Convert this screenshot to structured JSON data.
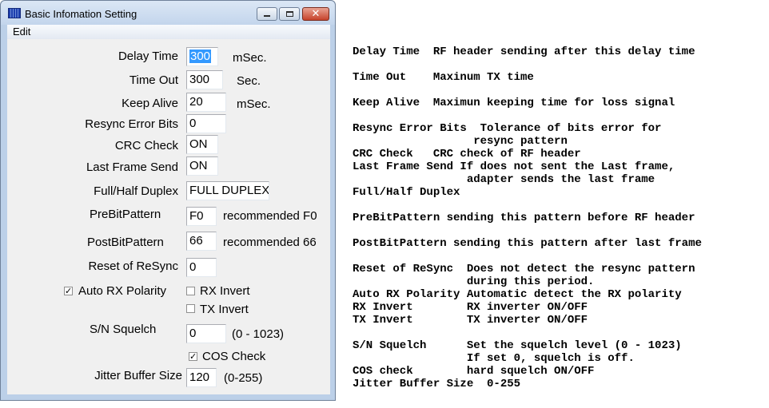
{
  "window": {
    "title": "Basic Infomation Setting",
    "close_symbol": "✕",
    "menu": {
      "edit": "Edit"
    }
  },
  "form": {
    "delay_time": {
      "label": "Delay Time",
      "value": "300",
      "unit": "mSec."
    },
    "time_out": {
      "label": "Time Out",
      "value": "300",
      "unit": "Sec."
    },
    "keep_alive": {
      "label": "Keep Alive",
      "value": "20",
      "unit": "mSec."
    },
    "resync_error_bits": {
      "label": "Resync Error Bits",
      "value": "0"
    },
    "crc_check": {
      "label": "CRC Check",
      "value": "ON"
    },
    "last_frame_send": {
      "label": "Last Frame Send",
      "value": "ON"
    },
    "full_half_duplex": {
      "label": "Full/Half Duplex",
      "value": "FULL DUPLEX"
    },
    "pre_bit_pattern": {
      "label": "PreBitPattern",
      "value": "F0",
      "note": "recommended F0"
    },
    "post_bit_pattern": {
      "label": "PostBitPattern",
      "value": "66",
      "note": "recommended 66"
    },
    "reset_of_resync": {
      "label": "Reset of ReSync",
      "value": "0"
    },
    "auto_rx_polarity": {
      "label": "Auto RX Polarity",
      "checked": true,
      "mark": "✓"
    },
    "rx_invert": {
      "label": "RX Invert",
      "checked": false
    },
    "tx_invert": {
      "label": "TX Invert",
      "checked": false
    },
    "sn_squelch": {
      "label": "S/N Squelch",
      "value": "0",
      "range": "(0 - 1023)"
    },
    "cos_check": {
      "label": "COS Check",
      "checked": true,
      "mark": "✓"
    },
    "jitter_buffer_size": {
      "label": "Jitter Buffer Size",
      "value": "120",
      "range": "(0-255)"
    }
  },
  "descriptions": [
    "Delay Time  RF header sending after this delay time",
    "Time Out    Maxinum TX time",
    "Keep Alive  Maximun keeping time for loss signal",
    "Resync Error Bits  Tolerance of bits error for\n                  resync pattern",
    "CRC Check   CRC check of RF header",
    "Last Frame Send If does not sent the Last frame,\n                 adapter sends the last frame",
    "Full/Half Duplex",
    "PreBitPattern sending this pattern before RF header",
    "PostBitPattern sending this pattern after last frame",
    "Reset of ReSync  Does not detect the resync pattern\n                 during this period.",
    "Auto RX Polarity Automatic detect the RX polarity",
    "RX Invert        RX inverter ON/OFF",
    "TX Invert        TX inverter ON/OFF",
    "S/N Squelch      Set the squelch level (0 - 1023)\n                 If set 0, squelch is off.",
    "COS check        hard squelch ON/OFF",
    "Jitter Buffer Size  0-255"
  ]
}
